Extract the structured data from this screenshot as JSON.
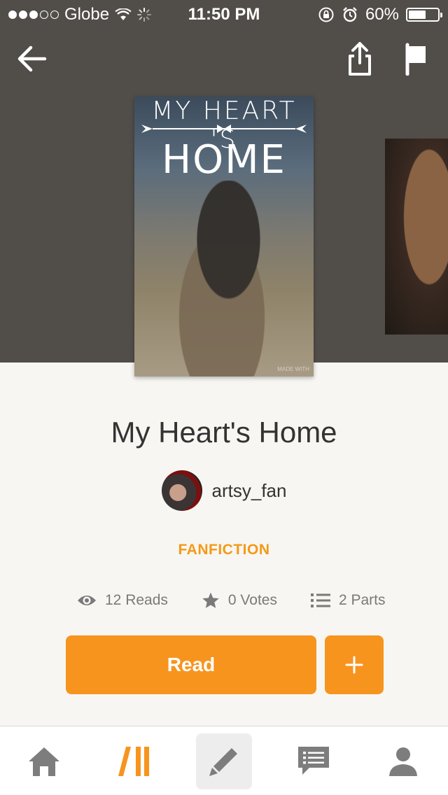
{
  "status_bar": {
    "carrier": "Globe",
    "time": "11:50 PM",
    "battery": "60%",
    "battery_level": 0.6
  },
  "story": {
    "cover_title_line1": "MY HEART 'S",
    "cover_title_line2": "HOME",
    "cover_credit": "MADE WITH",
    "title": "My Heart's Home",
    "author": "artsy_fan",
    "genre": "FANFICTION"
  },
  "stats": {
    "reads": "12 Reads",
    "votes": "0 Votes",
    "parts": "2 Parts"
  },
  "actions": {
    "read_label": "Read",
    "add_label": "+"
  },
  "tabs": [
    {
      "icon": "home-icon"
    },
    {
      "icon": "library-icon"
    },
    {
      "icon": "pencil-icon"
    },
    {
      "icon": "messages-icon"
    },
    {
      "icon": "profile-icon"
    }
  ],
  "colors": {
    "header_bg": "#514d49",
    "accent": "#f7941e",
    "page_bg": "#f7f6f2"
  }
}
